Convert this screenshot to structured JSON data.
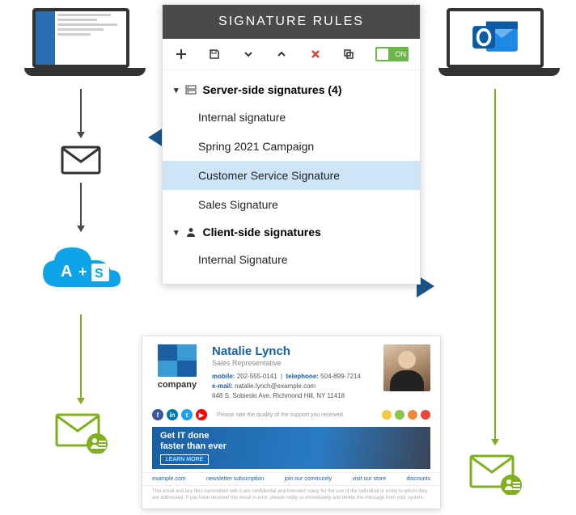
{
  "panel": {
    "title": "SIGNATURE RULES",
    "toggle_label": "ON",
    "groups": [
      {
        "key": "server",
        "label": "Server-side signatures (4)",
        "items": [
          "Internal signature",
          "Spring 2021 Campaign",
          "Customer Service Signature",
          "Sales Signature"
        ],
        "selected_index": 2
      },
      {
        "key": "client",
        "label": "Client-side signatures",
        "items": [
          "Internal Signature"
        ],
        "selected_index": -1
      }
    ]
  },
  "signature": {
    "company": "company",
    "name": "Natalie Lynch",
    "role": "Sales Representative",
    "mobile_label": "mobile:",
    "mobile": "202-555-0141",
    "tel_label": "telephone:",
    "tel": "504-899-7214",
    "email_label": "e-mail:",
    "email": "natalie.lynch@example.com",
    "address": "648 S. Sobieski Ave. Richmond Hill, NY 11418",
    "rate_text": "Please rate the quality of the support you received.",
    "banner_line1": "Get IT done",
    "banner_line2": "faster than ever",
    "banner_cta": "LEARN MORE",
    "links": [
      "example.com",
      "newsletter subscription",
      "join our community",
      "visit our store",
      "discounts"
    ],
    "disclaimer": "This email and any files transmitted with it are confidential and intended solely for the use of the individual or entity to whom they are addressed. If you have received this email in error, please notify us immediately and delete the message from your system."
  },
  "colors": {
    "accent_blue": "#1a5fa3",
    "green": "#80b020",
    "dark": "#4a4a4a"
  }
}
